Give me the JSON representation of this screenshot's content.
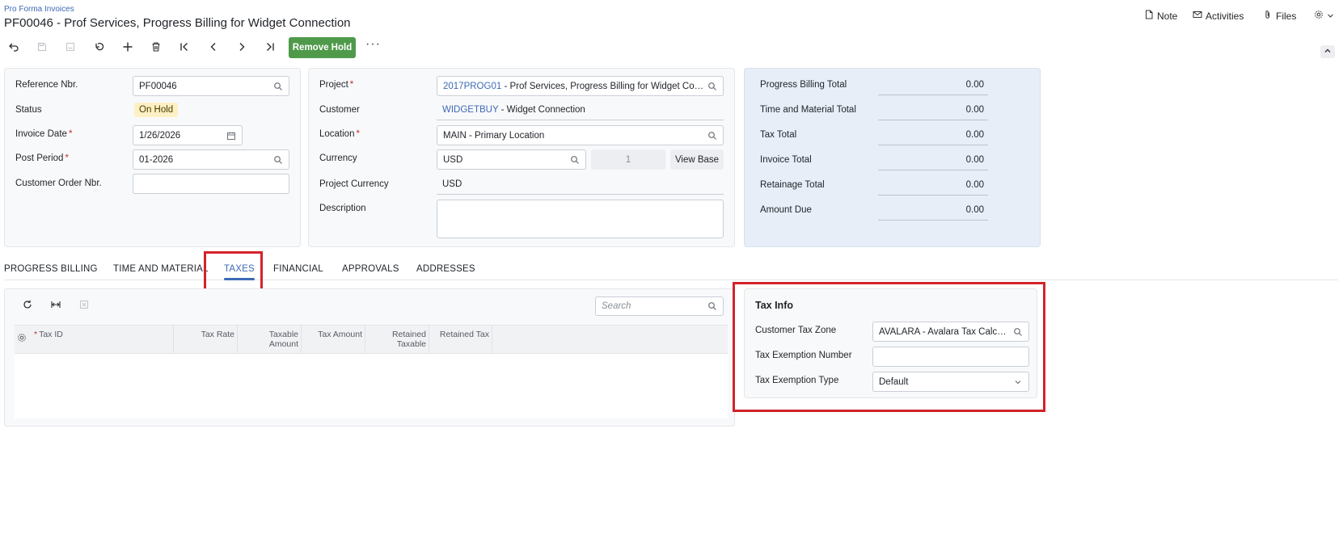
{
  "breadcrumb": "Pro Forma Invoices",
  "title": "PF00046 - Prof Services, Progress Billing for Widget Connection",
  "topbar": {
    "note": "Note",
    "activities": "Activities",
    "files": "Files"
  },
  "toolbar": {
    "remove_hold": "Remove Hold",
    "more": "···"
  },
  "form": {
    "reference_nbr_label": "Reference Nbr.",
    "reference_nbr": "PF00046",
    "status_label": "Status",
    "status": "On Hold",
    "invoice_date_label": "Invoice Date",
    "invoice_date": "1/26/2026",
    "post_period_label": "Post Period",
    "post_period": "01-2026",
    "customer_order_label": "Customer Order Nbr.",
    "customer_order": "",
    "project_label": "Project",
    "project_code": "2017PROG01",
    "project_desc": " - Prof Services, Progress Billing for Widget Con...",
    "customer_label": "Customer",
    "customer_code": "WIDGETBUY",
    "customer_name": " - Widget Connection",
    "location_label": "Location",
    "location": "MAIN - Primary Location",
    "currency_label": "Currency",
    "currency": "USD",
    "currency_rate": "1",
    "view_base": "View Base",
    "project_currency_label": "Project Currency",
    "project_currency": "USD",
    "description_label": "Description",
    "description": ""
  },
  "summary": [
    {
      "label": "Progress Billing Total",
      "value": "0.00"
    },
    {
      "label": "Time and Material Total",
      "value": "0.00"
    },
    {
      "label": "Tax Total",
      "value": "0.00"
    },
    {
      "label": "Invoice Total",
      "value": "0.00"
    },
    {
      "label": "Retainage Total",
      "value": "0.00"
    },
    {
      "label": "Amount Due",
      "value": "0.00"
    }
  ],
  "tabs": [
    "PROGRESS BILLING",
    "TIME AND MATERIAL",
    "TAXES",
    "FINANCIAL",
    "APPROVALS",
    "ADDRESSES"
  ],
  "active_tab": "TAXES",
  "grid": {
    "search_placeholder": "Search",
    "columns": {
      "tax_id": "Tax ID",
      "tax_rate": "Tax Rate",
      "taxable_amount_1": "Taxable",
      "taxable_amount_2": "Amount",
      "tax_amount": "Tax Amount",
      "retained_taxable_1": "Retained",
      "retained_taxable_2": "Taxable",
      "retained_tax": "Retained Tax"
    },
    "rows": []
  },
  "tax_info": {
    "heading": "Tax Info",
    "zone_label": "Customer Tax Zone",
    "zone": "AVALARA - Avalara Tax Calcul...",
    "exemption_number_label": "Tax Exemption Number",
    "exemption_number": "",
    "exemption_type_label": "Tax Exemption Type",
    "exemption_type": "Default"
  },
  "colors": {
    "accent": "#3d6ab5",
    "remove_hold": "#4f9a4a",
    "status_badge": "#fdf0c4",
    "highlight": "#d3232a",
    "summary_panel": "#e7eef8"
  }
}
